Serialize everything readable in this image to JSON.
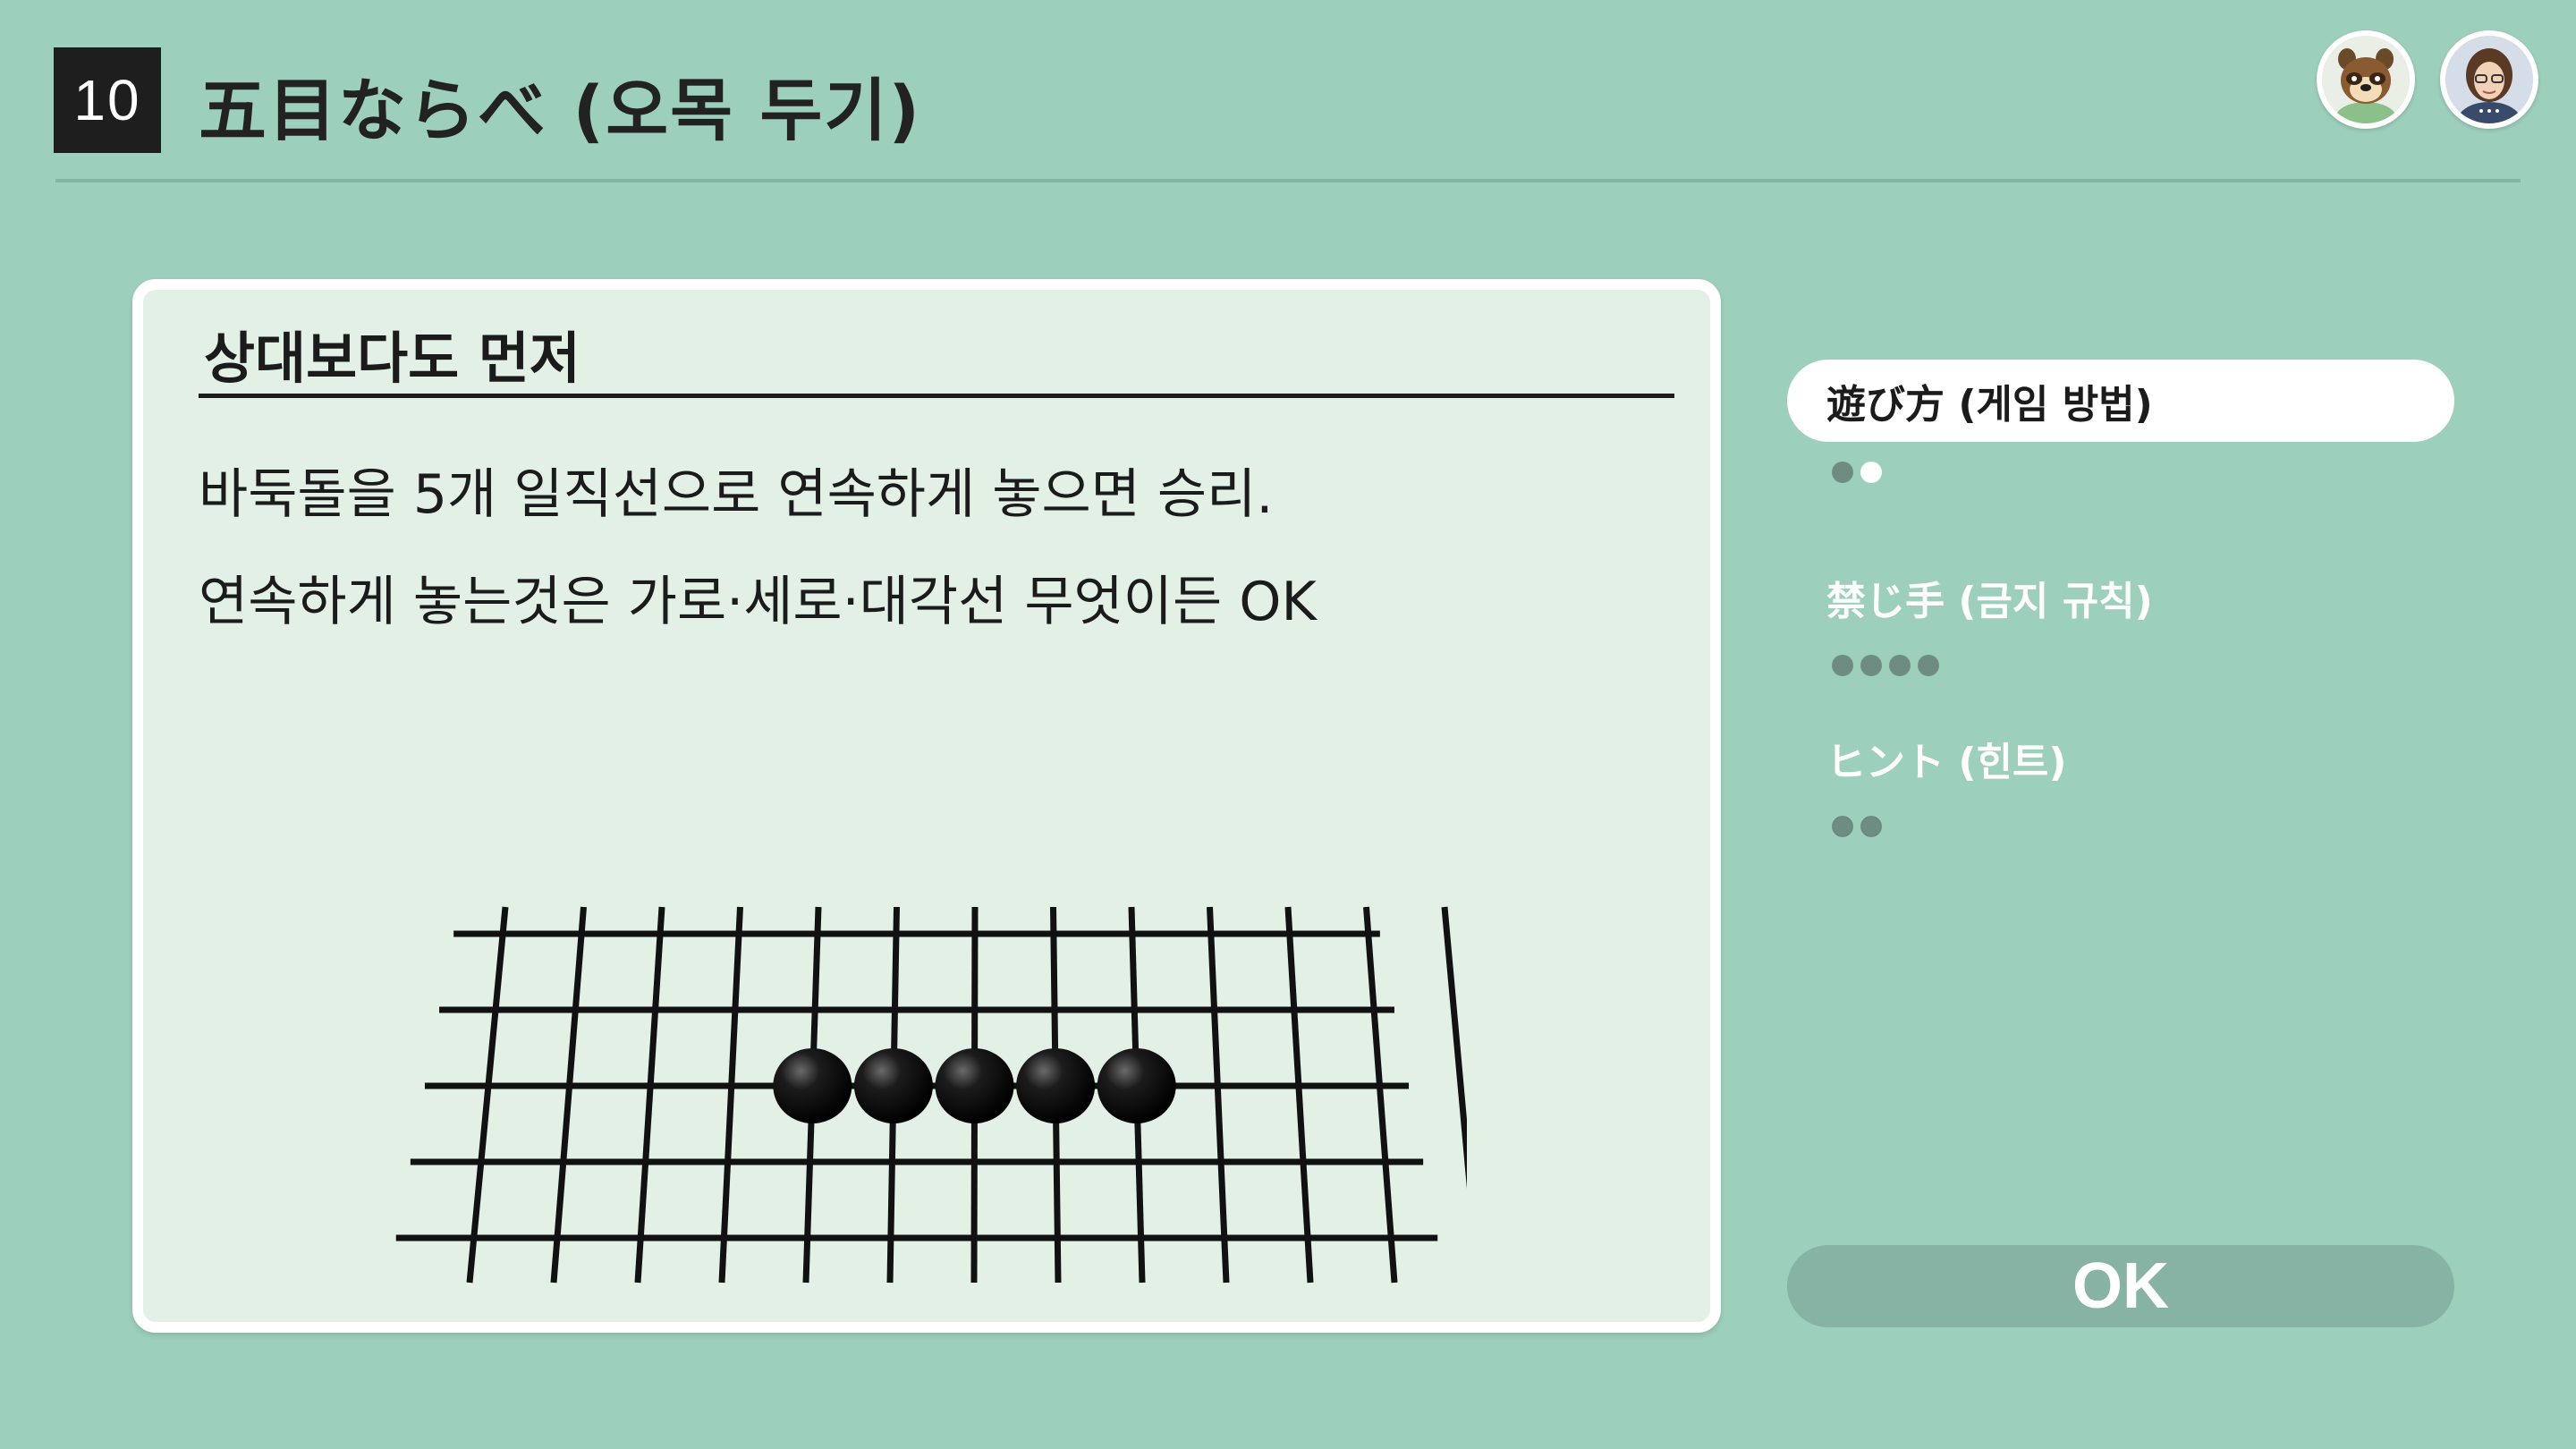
{
  "header": {
    "number": "10",
    "title": "五目ならべ (오목 두기)"
  },
  "avatars": [
    {
      "name": "tanuki-avatar"
    },
    {
      "name": "player-avatar"
    }
  ],
  "card": {
    "heading": "상대보다도 먼저",
    "lines": [
      "바둑돌을 5개 일직선으로 연속하게 놓으면 승리.",
      "연속하게 놓는것은 가로·세로·대각선 무엇이든 OK"
    ],
    "board": {
      "vertical_lines": 13,
      "horizontal_lines": 5,
      "stones": {
        "color": "black",
        "row": 2,
        "cols": [
          4,
          5,
          6,
          7,
          8
        ]
      }
    }
  },
  "menu": {
    "items": [
      {
        "label": "遊び方 (게임 방법)",
        "active": true,
        "pages": 2,
        "current": 2
      },
      {
        "label": "禁じ手 (금지 규칙)",
        "active": false,
        "pages": 4,
        "current": 0
      },
      {
        "label": "ヒント (힌트)",
        "active": false,
        "pages": 2,
        "current": 0
      }
    ]
  },
  "ok_button": {
    "label": "OK"
  },
  "colors": {
    "background": "#9dcfbd",
    "card": "#e3f0e5",
    "ok_button": "#86b3a3",
    "dot_grey": "#6e8c82"
  }
}
